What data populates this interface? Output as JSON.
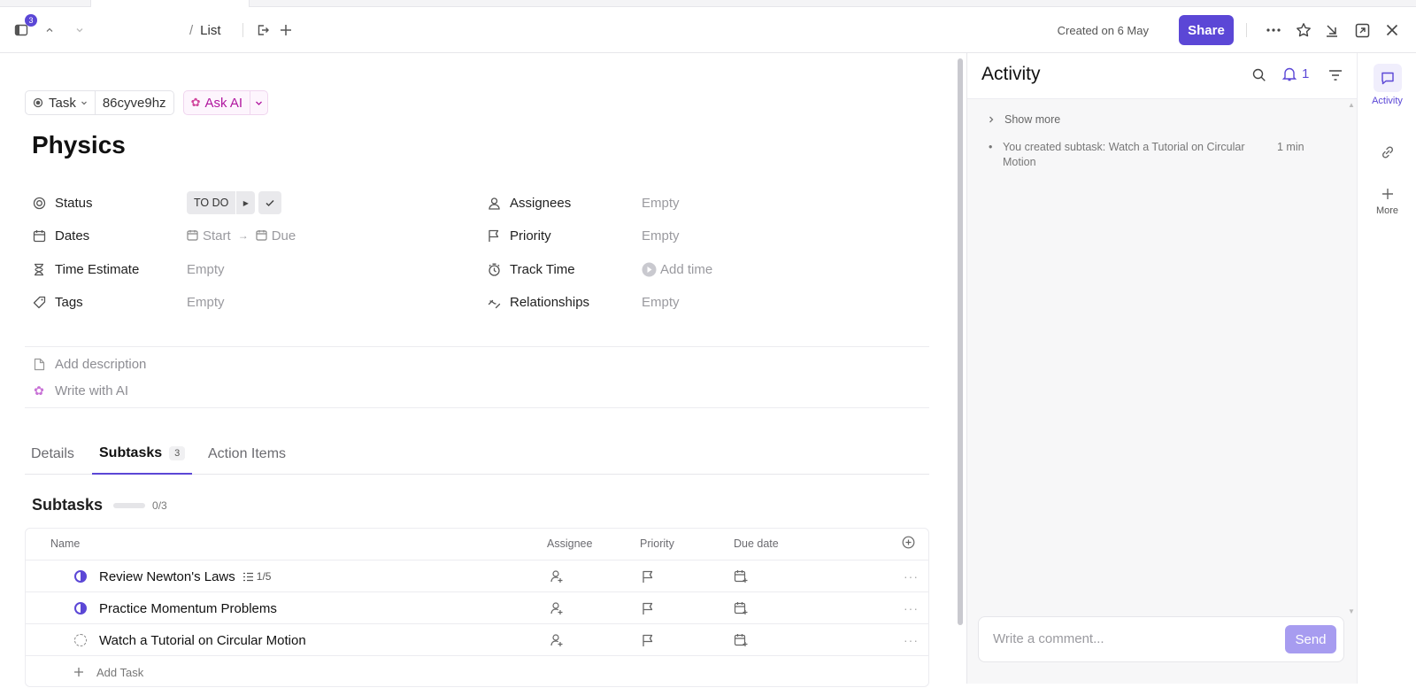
{
  "header": {
    "badge_count": "3",
    "breadcrumb": {
      "separator": "/",
      "current": "List"
    },
    "created_text": "Created on 6 May",
    "share_label": "Share"
  },
  "task": {
    "type_label": "Task",
    "id": "86cyve9hz",
    "ask_ai_label": "Ask AI",
    "title": "Physics"
  },
  "fields": {
    "status": {
      "label": "Status",
      "value": "TO DO"
    },
    "dates": {
      "label": "Dates",
      "start": "Start",
      "due": "Due"
    },
    "time_estimate": {
      "label": "Time Estimate",
      "value": "Empty"
    },
    "tags": {
      "label": "Tags",
      "value": "Empty"
    },
    "assignees": {
      "label": "Assignees",
      "value": "Empty"
    },
    "priority": {
      "label": "Priority",
      "value": "Empty"
    },
    "track_time": {
      "label": "Track Time",
      "value": "Add time"
    },
    "relationships": {
      "label": "Relationships",
      "value": "Empty"
    }
  },
  "description": {
    "add_label": "Add description",
    "ai_label": "Write with AI"
  },
  "tabs": [
    {
      "label": "Details"
    },
    {
      "label": "Subtasks",
      "count": "3"
    },
    {
      "label": "Action Items"
    }
  ],
  "subtasks": {
    "heading": "Subtasks",
    "progress": 0,
    "progress_text": "0/3",
    "columns": {
      "name": "Name",
      "assignee": "Assignee",
      "priority": "Priority",
      "due": "Due date"
    },
    "rows": [
      {
        "name": "Review Newton's Laws",
        "status": "in-progress",
        "checklist": "1/5"
      },
      {
        "name": "Practice Momentum Problems",
        "status": "in-progress",
        "checklist": ""
      },
      {
        "name": "Watch a Tutorial on Circular Motion",
        "status": "todo",
        "checklist": ""
      }
    ],
    "add_label": "Add Task"
  },
  "activity": {
    "title": "Activity",
    "notif_count": "1",
    "show_more": "Show more",
    "entry_text": "You created subtask: Watch a Tutorial on Circular Motion",
    "entry_time": "1 min",
    "comment_placeholder": "Write a comment...",
    "send_label": "Send"
  },
  "rail": {
    "activity_label": "Activity",
    "more_label": "More"
  },
  "colors": {
    "accent": "#5b47d6",
    "ai": "#b0169f"
  }
}
